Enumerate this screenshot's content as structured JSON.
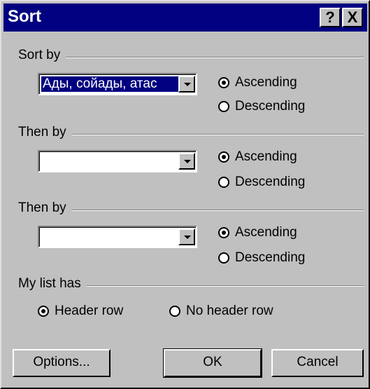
{
  "window": {
    "title": "Sort",
    "help_glyph": "?",
    "close_glyph": "X"
  },
  "sort_by": {
    "label": "Sort by",
    "value": "Ады, сойады, атас",
    "ascending": "Ascending",
    "descending": "Descending",
    "selected": "ascending"
  },
  "then_by_1": {
    "label": "Then by",
    "value": "",
    "ascending": "Ascending",
    "descending": "Descending",
    "selected": "ascending"
  },
  "then_by_2": {
    "label": "Then by",
    "value": "",
    "ascending": "Ascending",
    "descending": "Descending",
    "selected": "ascending"
  },
  "my_list_has": {
    "label": "My list has",
    "header_row": "Header row",
    "no_header_row": "No header row",
    "selected": "header_row"
  },
  "buttons": {
    "options": "Options...",
    "ok": "OK",
    "cancel": "Cancel"
  }
}
